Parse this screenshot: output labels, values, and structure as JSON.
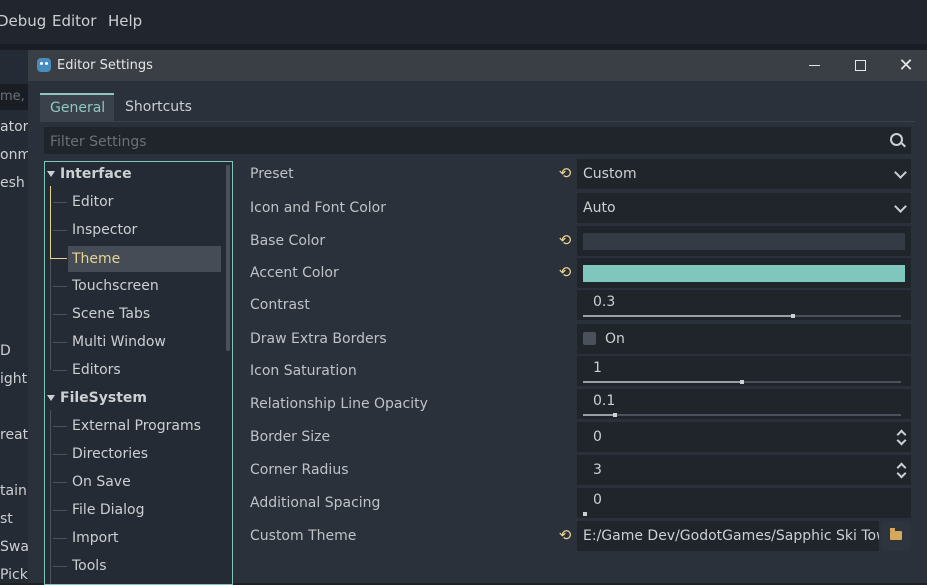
{
  "main_menu": {
    "items": [
      "Debug",
      "Editor",
      "Help"
    ]
  },
  "background_left": {
    "filter_stub": "me,",
    "items": [
      "ator",
      "onme",
      "esh",
      "D",
      "ight",
      "reato",
      "tain",
      "st",
      "Swat",
      "Picke"
    ]
  },
  "dialog": {
    "title": "Editor Settings",
    "tabs": [
      {
        "label": "General",
        "active": true
      },
      {
        "label": "Shortcuts",
        "active": false
      }
    ],
    "filter": {
      "placeholder": "Filter Settings",
      "value": ""
    },
    "tree": {
      "categories": [
        {
          "label": "Interface",
          "expanded": true,
          "children": [
            "Editor",
            "Inspector",
            "Theme",
            "Touchscreen",
            "Scene Tabs",
            "Multi Window",
            "Editors"
          ]
        },
        {
          "label": "FileSystem",
          "expanded": true,
          "children": [
            "External Programs",
            "Directories",
            "On Save",
            "File Dialog",
            "Import",
            "Tools"
          ]
        }
      ],
      "selected": "Theme"
    },
    "properties": {
      "preset": {
        "label": "Preset",
        "value": "Custom"
      },
      "icon_font_color": {
        "label": "Icon and Font Color",
        "value": "Auto"
      },
      "base_color": {
        "label": "Base Color",
        "color": "#353b45"
      },
      "accent_color": {
        "label": "Accent Color",
        "color": "#7fc7bc"
      },
      "contrast": {
        "label": "Contrast",
        "value": "0.3",
        "fraction": 0.66
      },
      "draw_extra_borders": {
        "label": "Draw Extra Borders",
        "value": "On",
        "checked": false
      },
      "icon_saturation": {
        "label": "Icon Saturation",
        "value": "1",
        "fraction": 0.5
      },
      "relationship_line_opacity": {
        "label": "Relationship Line Opacity",
        "value": "0.1",
        "fraction": 0.1
      },
      "border_size": {
        "label": "Border Size",
        "value": "0"
      },
      "corner_radius": {
        "label": "Corner Radius",
        "value": "3"
      },
      "additional_spacing": {
        "label": "Additional Spacing",
        "value": "0",
        "fraction": 0
      },
      "custom_theme": {
        "label": "Custom Theme",
        "value": "E:/Game Dev/GodotGames/Sapphic Ski Tow"
      }
    }
  }
}
